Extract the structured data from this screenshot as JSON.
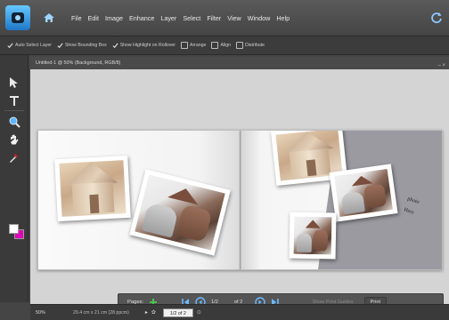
{
  "menu": {
    "items": [
      "File",
      "Edit",
      "Image",
      "Enhance",
      "Layer",
      "Select",
      "Filter",
      "View",
      "Window",
      "Help"
    ]
  },
  "options": {
    "auto_select": "Auto Select Layer",
    "bounding_box": "Show Bounding Box",
    "highlight": "Show Highlight on Rollover",
    "arrange": "Arrange",
    "align": "Align",
    "distribute": "Distribute"
  },
  "document": {
    "title": "Untitled-1 @ 50% (Background, RGB/8)"
  },
  "canvas": {
    "caption_line1": "photo",
    "caption_line2": "Here"
  },
  "pages_panel": {
    "label": "Pages:",
    "current": "1/2",
    "total": "of 2",
    "show_print_guides": "Show Print Guides",
    "print": "Print"
  },
  "status": {
    "zoom": "50%",
    "doc_size": "29.4 cm x 21 cm (28 ppcm)",
    "page_field": "1/2 of 2"
  },
  "colors": {
    "foreground": "#ffffff",
    "background": "#e000b8",
    "accent": "#1e78c8"
  }
}
